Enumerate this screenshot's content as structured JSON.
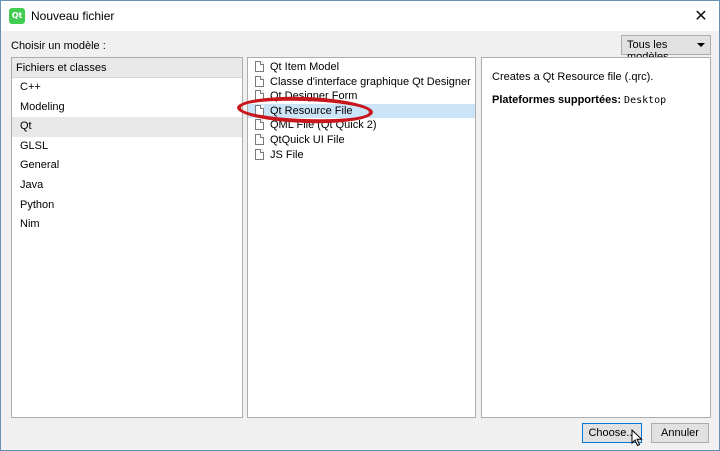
{
  "window": {
    "title": "Nouveau fichier",
    "app_icon_text": "Qt",
    "close_glyph": "✕"
  },
  "choose_label": "Choisir un modèle :",
  "filter": {
    "selected": "Tous les modèles"
  },
  "categories": {
    "header": "Fichiers et classes",
    "items": [
      "C++",
      "Modeling",
      "Qt",
      "GLSL",
      "General",
      "Java",
      "Python",
      "Nim"
    ],
    "selected": "Qt"
  },
  "templates": {
    "items": [
      "Qt Item Model",
      "Classe d'interface graphique Qt Designer",
      "Qt Designer Form",
      "Qt Resource File",
      "QML File (Qt Quick 2)",
      "QtQuick UI File",
      "JS File"
    ],
    "selected": "Qt Resource File"
  },
  "details": {
    "description": "Creates a Qt Resource file (.qrc).",
    "platforms_label": "Plateformes supportées:",
    "platforms_value": "Desktop"
  },
  "buttons": {
    "choose": "Choose...",
    "cancel": "Annuler"
  },
  "colors": {
    "selection": "#cce4f7",
    "annotation": "#c8161d",
    "qt_green": "#41cd52"
  }
}
